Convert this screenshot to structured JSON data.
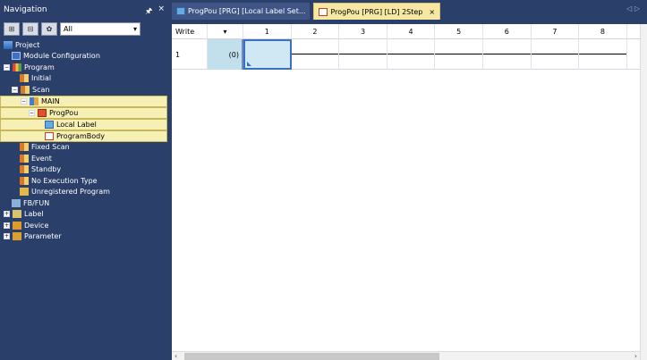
{
  "nav": {
    "title": "Navigation",
    "pin_icon": "pin-icon",
    "close_glyph": "×",
    "filter_value": "All"
  },
  "tree": [
    {
      "label": "Project",
      "icon": "project-icon",
      "indent": 0,
      "exp": ""
    },
    {
      "label": "Module Configuration",
      "icon": "module-icon",
      "indent": 1,
      "exp": ""
    },
    {
      "label": "Program",
      "icon": "program-icon",
      "indent": 0,
      "exp": "-"
    },
    {
      "label": "Initial",
      "icon": "task-icon",
      "indent": 2,
      "exp": ""
    },
    {
      "label": "Scan",
      "icon": "task-icon",
      "indent": 1,
      "exp": "-"
    },
    {
      "label": "MAIN",
      "icon": "main-icon",
      "indent": 2,
      "exp": "-",
      "hl": true
    },
    {
      "label": "ProgPou",
      "icon": "pou-icon",
      "indent": 3,
      "exp": "-",
      "hl": true
    },
    {
      "label": "Local Label",
      "icon": "local-label-icon",
      "indent": 5,
      "exp": "",
      "hl": true
    },
    {
      "label": "ProgramBody",
      "icon": "program-body-icon",
      "indent": 5,
      "exp": "",
      "hl": true
    },
    {
      "label": "Fixed Scan",
      "icon": "task-icon",
      "indent": 2,
      "exp": ""
    },
    {
      "label": "Event",
      "icon": "task-icon",
      "indent": 2,
      "exp": ""
    },
    {
      "label": "Standby",
      "icon": "task-icon",
      "indent": 2,
      "exp": ""
    },
    {
      "label": "No Execution Type",
      "icon": "task-icon",
      "indent": 2,
      "exp": ""
    },
    {
      "label": "Unregistered Program",
      "icon": "unregistered-icon",
      "indent": 2,
      "exp": ""
    },
    {
      "label": "FB/FUN",
      "icon": "fbfun-icon",
      "indent": 1,
      "exp": ""
    },
    {
      "label": "Label",
      "icon": "label-icon",
      "indent": 0,
      "exp": "+"
    },
    {
      "label": "Device",
      "icon": "device-icon",
      "indent": 0,
      "exp": "+"
    },
    {
      "label": "Parameter",
      "icon": "parameter-icon",
      "indent": 0,
      "exp": "+"
    }
  ],
  "tabs": [
    {
      "label": "ProgPou [PRG] [Local Label Set...",
      "active": false
    },
    {
      "label": "ProgPou [PRG] [LD] 2Step",
      "active": true,
      "close": "×"
    }
  ],
  "editor": {
    "mode": "Write",
    "columns": [
      "1",
      "2",
      "3",
      "4",
      "5",
      "6",
      "7",
      "8"
    ],
    "row_number": "1",
    "step": "(0)"
  }
}
